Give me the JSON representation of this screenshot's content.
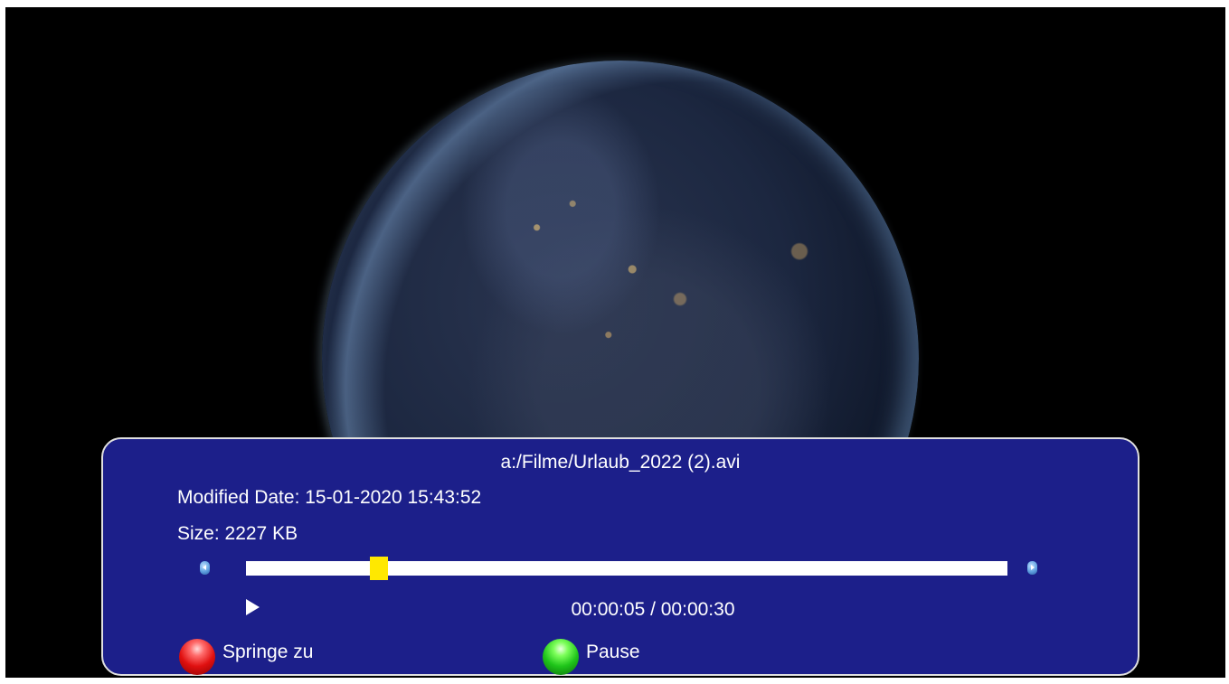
{
  "player": {
    "file_path": "a:/Filme/Urlaub_2022 (2).avi",
    "modified_date": "Modified Date: 15-01-2020 15:43:52",
    "size": "Size: 2227 KB",
    "time_display": "00:00:05 / 00:00:30",
    "progress_fraction": 0.175,
    "playback_state_icon": "play-icon"
  },
  "color_keys": [
    {
      "color": "red",
      "label": "Springe zu"
    },
    {
      "color": "green",
      "label": "Pause"
    }
  ],
  "colors": {
    "panel_background": "#1c1f8a",
    "panel_border": "#e0e0e0",
    "progress_track": "#ffffff",
    "progress_thumb": "#ffe800",
    "screen_background": "#000000"
  }
}
